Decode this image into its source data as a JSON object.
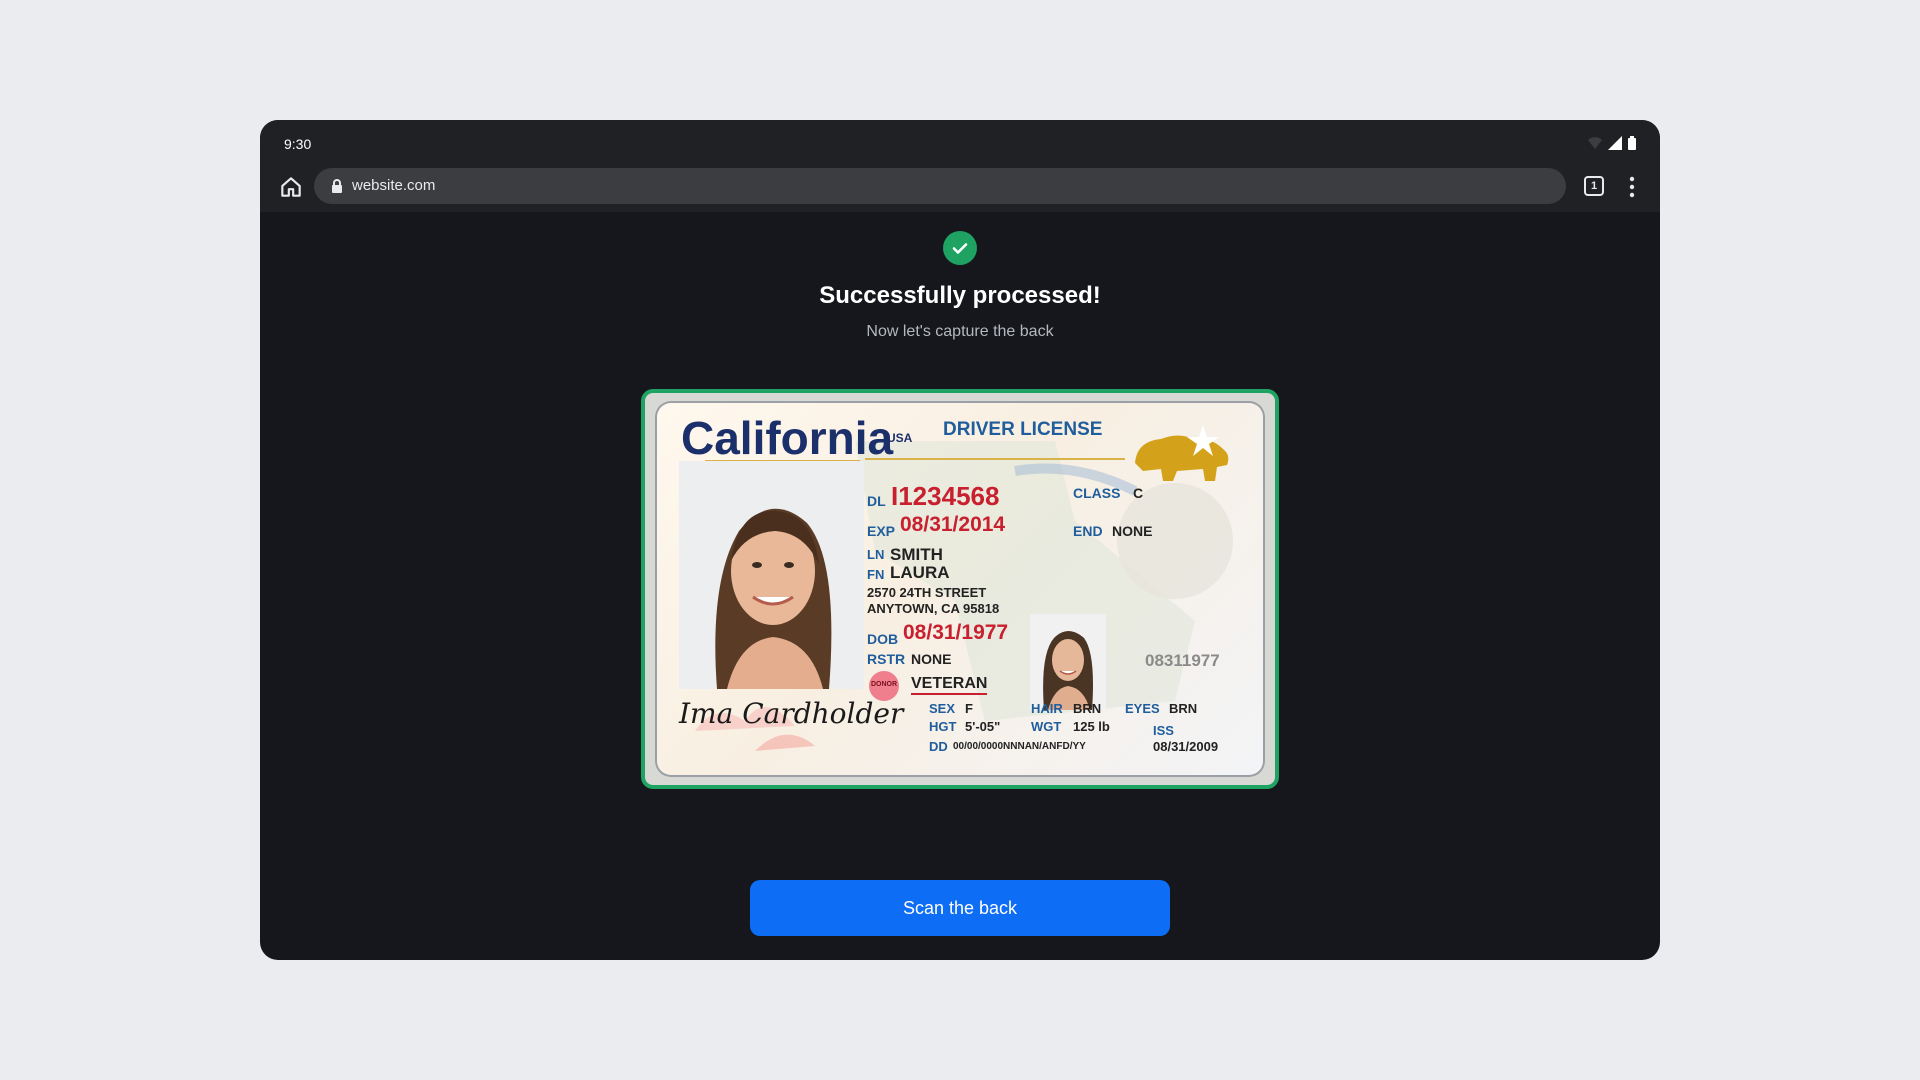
{
  "status_bar": {
    "time": "9:30"
  },
  "browser": {
    "url": "website.com",
    "tab_count": "1"
  },
  "content": {
    "title": "Successfully processed!",
    "subtitle": "Now let's capture the back",
    "button_label": "Scan the back"
  },
  "id_card": {
    "state": "California",
    "country": "USA",
    "doc_type": "DRIVER LICENSE",
    "dl_label": "DL",
    "dl_number": "I1234568",
    "exp_label": "EXP",
    "exp": "08/31/2014",
    "class_label": "CLASS",
    "class": "C",
    "end_label": "END",
    "end": "NONE",
    "ln_label": "LN",
    "last_name": "SMITH",
    "fn_label": "FN",
    "first_name": "LAURA",
    "address1": "2570 24TH STREET",
    "address2": "ANYTOWN, CA 95818",
    "dob_label": "DOB",
    "dob": "08/31/1977",
    "rstr_label": "RSTR",
    "rstr": "NONE",
    "donor": "DONOR",
    "veteran": "VETERAN",
    "sex_label": "SEX",
    "sex": "F",
    "hgt_label": "HGT",
    "height": "5'-05\"",
    "hair_label": "HAIR",
    "hair": "BRN",
    "wgt_label": "WGT",
    "weight": "125 lb",
    "eyes_label": "EYES",
    "eyes": "BRN",
    "dd_label": "DD",
    "dd": "00/00/0000NNNAN/ANFD/YY",
    "iss_label": "ISS",
    "iss": "08/31/2009",
    "ghost_number": "08311977",
    "signature": "Ima Cardholder"
  },
  "colors": {
    "accent": "#0d6df4",
    "success": "#1ea362",
    "background": "#15171c"
  }
}
